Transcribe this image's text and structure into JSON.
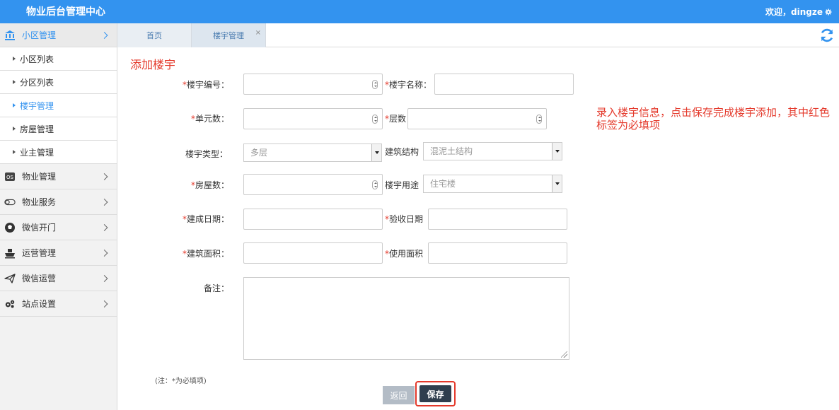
{
  "header": {
    "app_title": "物业后台管理中心",
    "welcome": "欢迎，dingze",
    "accent": "#3393ef"
  },
  "sidebar": {
    "groups": [
      {
        "label": "小区管理",
        "icon": "bank-icon",
        "open": true,
        "items": [
          {
            "label": "小区列表"
          },
          {
            "label": "分区列表"
          },
          {
            "label": "楼宇管理",
            "active": true
          },
          {
            "label": "房屋管理"
          },
          {
            "label": "业主管理"
          }
        ]
      },
      {
        "label": "物业管理",
        "icon": "os-badge-icon"
      },
      {
        "label": "物业服务",
        "icon": "toggle-icon"
      },
      {
        "label": "微信开门",
        "icon": "soccer-ball-icon"
      },
      {
        "label": "运营管理",
        "icon": "ship-icon"
      },
      {
        "label": "微信运营",
        "icon": "paper-plane-icon"
      },
      {
        "label": "站点设置",
        "icon": "gears-icon"
      }
    ]
  },
  "tabs": [
    {
      "label": "首页"
    },
    {
      "label": "楼宇管理",
      "close": "×"
    }
  ],
  "form": {
    "heading": "添加楼宇",
    "hint": "录入楼宇信息，点击保存完成楼宇添加，其中红色标签为必填项",
    "req_mark": "*",
    "building_no_label": "楼宇编号：",
    "building_name_label": "楼宇名称：",
    "units_label": "单元数：",
    "floors_label": "层数",
    "building_type_label": "楼宇类型：",
    "building_type_value": "多层",
    "structure_label": "建筑结构",
    "structure_value": "混泥土结构",
    "rooms_label": "房屋数：",
    "usage_label": "楼宇用途",
    "usage_value": "住宅楼",
    "built_date_label": "建成日期：",
    "accept_date_label": "验收日期",
    "floor_area_label": "建筑面积：",
    "usable_area_label": "使用面积",
    "remark_label": "备注：",
    "note": "(注：*为必填项)",
    "back_button": "返回",
    "save_button": "保存"
  }
}
